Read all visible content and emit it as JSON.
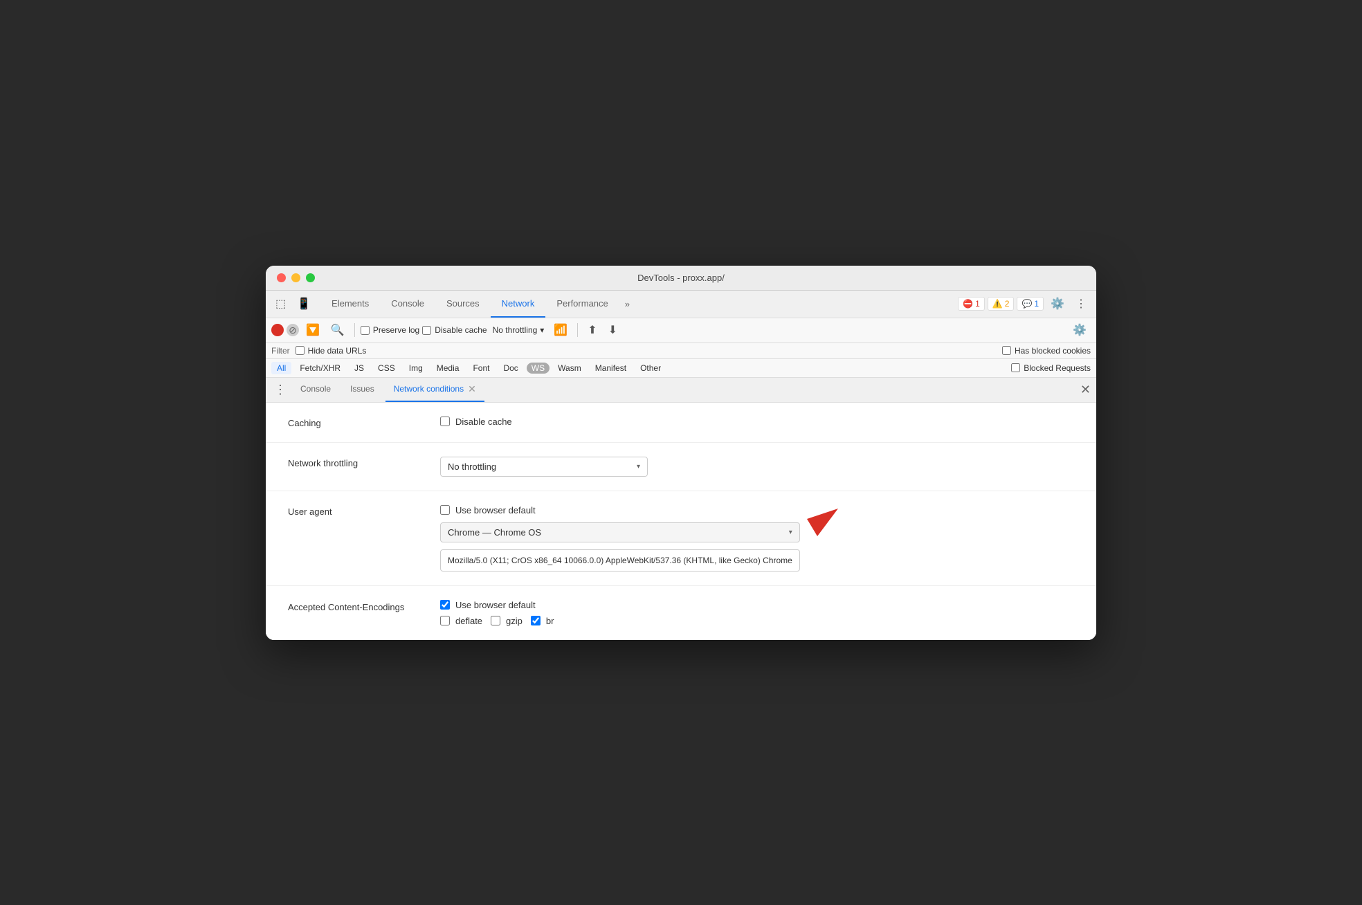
{
  "window": {
    "title": "DevTools - proxx.app/"
  },
  "tabs": {
    "items": [
      {
        "id": "elements",
        "label": "Elements",
        "active": false
      },
      {
        "id": "console",
        "label": "Console",
        "active": false
      },
      {
        "id": "sources",
        "label": "Sources",
        "active": false
      },
      {
        "id": "network",
        "label": "Network",
        "active": true
      },
      {
        "id": "performance",
        "label": "Performance",
        "active": false
      }
    ],
    "more_label": "»",
    "error_badge": "1",
    "warning_badge": "2",
    "info_badge": "1"
  },
  "toolbar": {
    "preserve_log_label": "Preserve log",
    "disable_cache_label": "Disable cache",
    "throttle_label": "No throttling"
  },
  "filter": {
    "label": "Filter",
    "hide_data_urls_label": "Hide data URLs",
    "has_blocked_cookies_label": "Has blocked cookies",
    "blocked_requests_label": "Blocked Requests"
  },
  "resource_types": [
    {
      "id": "all",
      "label": "All",
      "active": true
    },
    {
      "id": "fetch-xhr",
      "label": "Fetch/XHR",
      "active": false
    },
    {
      "id": "js",
      "label": "JS",
      "active": false
    },
    {
      "id": "css",
      "label": "CSS",
      "active": false
    },
    {
      "id": "img",
      "label": "Img",
      "active": false
    },
    {
      "id": "media",
      "label": "Media",
      "active": false
    },
    {
      "id": "font",
      "label": "Font",
      "active": false
    },
    {
      "id": "doc",
      "label": "Doc",
      "active": false
    },
    {
      "id": "ws",
      "label": "WS",
      "active": false,
      "badge": true
    },
    {
      "id": "wasm",
      "label": "Wasm",
      "active": false
    },
    {
      "id": "manifest",
      "label": "Manifest",
      "active": false
    },
    {
      "id": "other",
      "label": "Other",
      "active": false
    }
  ],
  "bottom_tabs": {
    "items": [
      {
        "id": "console",
        "label": "Console",
        "active": false,
        "closable": false
      },
      {
        "id": "issues",
        "label": "Issues",
        "active": false,
        "closable": false
      },
      {
        "id": "network-conditions",
        "label": "Network conditions",
        "active": true,
        "closable": true
      }
    ]
  },
  "network_conditions": {
    "caching": {
      "label": "Caching",
      "disable_cache_label": "Disable cache",
      "disable_cache_checked": false
    },
    "throttling": {
      "label": "Network throttling",
      "selected_value": "No throttling"
    },
    "user_agent": {
      "label": "User agent",
      "use_browser_default_label": "Use browser default",
      "use_browser_default_checked": false,
      "selected_ua": "Chrome — Chrome OS",
      "ua_string": "Mozilla/5.0 (X11; CrOS x86_64 10066.0.0) AppleWebKit/537.36 (KHTML, like Gecko) Chrome"
    },
    "accepted_encodings": {
      "label": "Accepted Content-Encodings",
      "use_browser_default_label": "Use browser default",
      "use_browser_default_checked": true,
      "deflate_label": "deflate",
      "deflate_checked": false,
      "gzip_label": "gzip",
      "gzip_checked": false,
      "br_label": "br",
      "br_checked": true
    }
  }
}
